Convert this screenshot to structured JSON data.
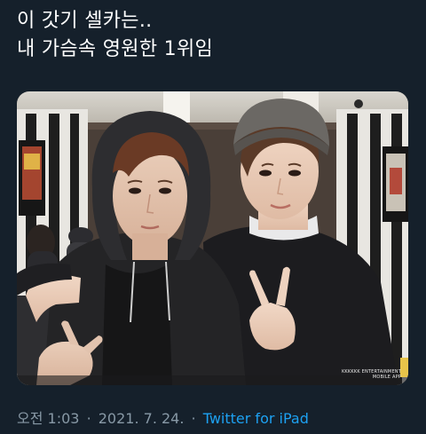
{
  "tweet": {
    "text_lines": [
      "이 갓기 셀카는..",
      "내 가슴속 영원한 1위임"
    ],
    "media": {
      "watermark_line1": "KKKKKK ENTERTAINMENT",
      "watermark_line2": "MOBILE APP"
    },
    "time": "오전 1:03",
    "date": "2021. 7. 24.",
    "separator": "·",
    "source": "Twitter for iPad"
  },
  "colors": {
    "background": "#15202b",
    "text": "#ffffff",
    "meta": "#8899a6",
    "link": "#1da1f2"
  }
}
